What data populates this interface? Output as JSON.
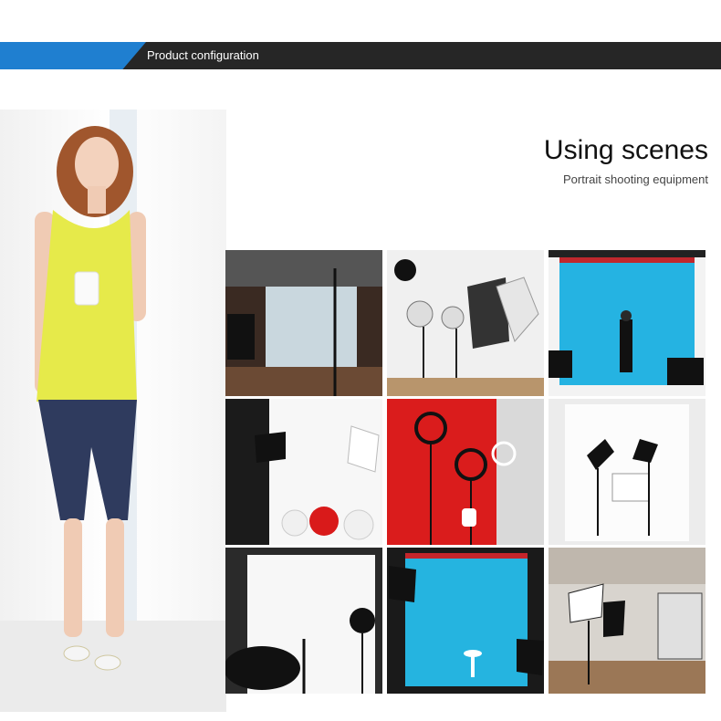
{
  "banner": {
    "title": "Product configuration",
    "accent_color": "#1f7fd0",
    "bar_color": "#262626"
  },
  "section": {
    "heading": "Using scenes",
    "subheading": "Portrait shooting equipment"
  },
  "images": {
    "model": "woman-in-yellow-tank-top-photo",
    "tiles": [
      "studio-window-room-photo",
      "studio-lights-white-room-photo",
      "blue-backdrop-model-photo",
      "white-studio-balloons-photo",
      "red-backdrop-ring-lights-photo",
      "white-backdrop-softboxes-photo",
      "white-backdrop-umbrella-photo",
      "blue-backdrop-stool-photo",
      "studio-office-softboxes-photo"
    ]
  }
}
